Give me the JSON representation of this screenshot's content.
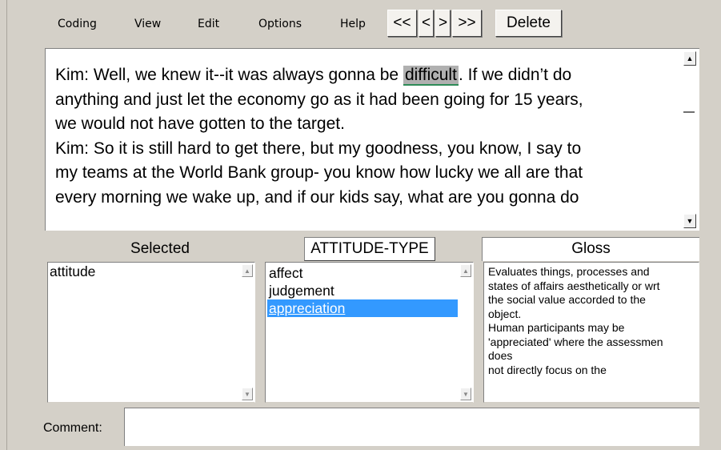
{
  "menu": {
    "items": [
      "Coding",
      "View",
      "Edit",
      "Options",
      "Help"
    ]
  },
  "nav": {
    "first": "<<",
    "prev": "<",
    "next": ">",
    "last": ">>",
    "delete": "Delete"
  },
  "document": {
    "lines": [
      {
        "before": "Kim: Well, we knew it--it was always gonna be ",
        "highlight": "difficult",
        "after": ". If we didn’t do"
      },
      {
        "text": "anything and just let the economy go as it had been going for 15 years,"
      },
      {
        "text": "we would not have gotten to the target."
      },
      {
        "text": "Kim: So it is still hard to get there, but my goodness, you know, I say to"
      },
      {
        "text": "my teams at the World Bank group- you know how lucky we all are that"
      },
      {
        "text": "every morning we wake up, and if our kids say, what are you gonna do"
      }
    ]
  },
  "panels": {
    "selected": {
      "header": "Selected",
      "items": [
        "attitude"
      ]
    },
    "category": {
      "header": "ATTITUDE-TYPE",
      "items": [
        "affect",
        "judgement",
        "appreciation"
      ],
      "selected_index": 2
    },
    "gloss": {
      "header": "Gloss",
      "lines": [
        "Evaluates things, processes and",
        "states of affairs aesthetically or wrt",
        "the social value accorded to the",
        "object.",
        "Human participants may be",
        "'appreciated' where the assessmen",
        "does",
        "not directly focus on the"
      ]
    }
  },
  "comment": {
    "label": "Comment:",
    "value": ""
  },
  "colors": {
    "window_bg": "#d4d0c8",
    "selection": "#3399ff",
    "highlight_bg": "#b0b0b0",
    "highlight_underline": "#2e8b57"
  }
}
